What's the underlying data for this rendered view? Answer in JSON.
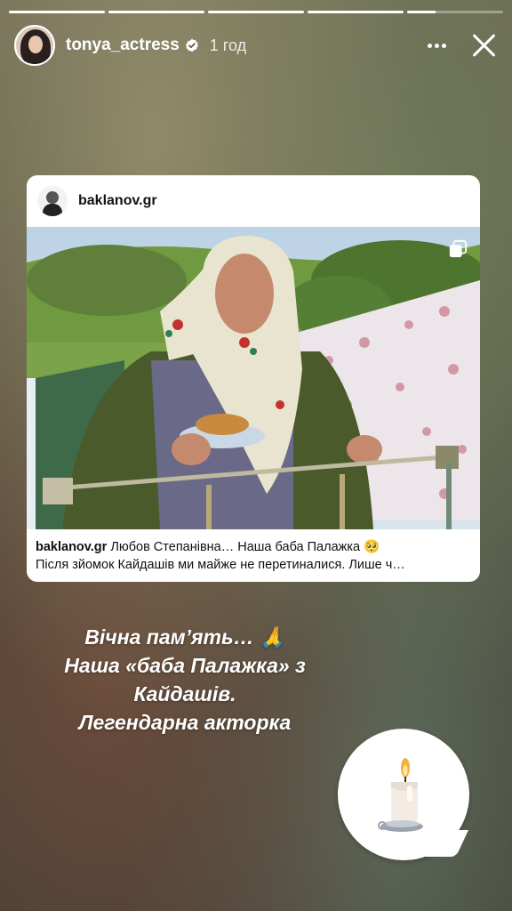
{
  "progress": {
    "segments": [
      1,
      1,
      1,
      1,
      0.3
    ]
  },
  "header": {
    "username": "tonya_actress",
    "time": "1 год",
    "more_icon": "more-horizontal-icon",
    "close_icon": "close-icon",
    "verified_icon": "verified-badge-icon"
  },
  "post": {
    "username": "baklanov.gr",
    "caption_line1": "Любов Степанівна… Наша баба Палажка 🥺",
    "caption_line2": "Після зйомок Кайдашів ми майже не перетиналися. Лише ч…",
    "multi_icon": "carousel-icon"
  },
  "story_text": {
    "line1": "Вічна пам’ять… 🙏",
    "line2": "Наша «баба Палажка» з",
    "line3": "Кайдашів.",
    "line4": "Легендарна акторка"
  },
  "sticker": {
    "icon": "candle-icon"
  },
  "colors": {
    "accent": "#ffffff",
    "card_bg": "#ffffff"
  }
}
